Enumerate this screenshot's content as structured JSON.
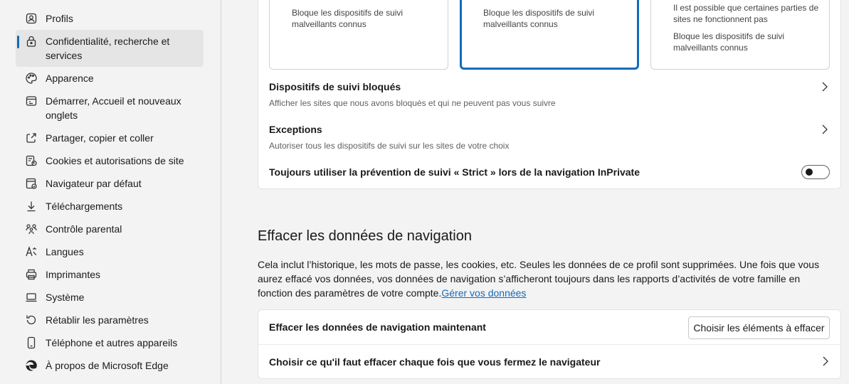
{
  "sidebar": {
    "items": [
      {
        "label": "Profils",
        "icon": "profile-icon"
      },
      {
        "label": "Confidentialité, recherche et services",
        "icon": "lock-icon",
        "active": true
      },
      {
        "label": "Apparence",
        "icon": "palette-icon"
      },
      {
        "label": "Démarrer, Accueil et nouveaux onglets",
        "icon": "home-tabs-icon"
      },
      {
        "label": "Partager, copier et coller",
        "icon": "share-icon"
      },
      {
        "label": "Cookies et autorisations de site",
        "icon": "cookies-icon"
      },
      {
        "label": "Navigateur par défaut",
        "icon": "default-browser-icon"
      },
      {
        "label": "Téléchargements",
        "icon": "download-icon"
      },
      {
        "label": "Contrôle parental",
        "icon": "family-icon"
      },
      {
        "label": "Langues",
        "icon": "language-icon"
      },
      {
        "label": "Imprimantes",
        "icon": "printer-icon"
      },
      {
        "label": "Système",
        "icon": "laptop-icon"
      },
      {
        "label": "Rétablir les paramètres",
        "icon": "reset-icon"
      },
      {
        "label": "Téléphone et autres appareils",
        "icon": "phone-icon"
      },
      {
        "label": "À propos de Microsoft Edge",
        "icon": "edge-logo-icon"
      }
    ]
  },
  "tracking": {
    "cards": [
      {
        "lines": [
          "Bloque les dispositifs de suivi malveillants connus"
        ],
        "selected": false
      },
      {
        "lines": [
          "Bloque les dispositifs de suivi malveillants connus"
        ],
        "selected": true
      },
      {
        "lines": [
          "Il est possible que certaines parties de sites ne fonctionnent pas",
          "Bloque les dispositifs de suivi malveillants connus"
        ],
        "selected": false
      }
    ],
    "blocked_title": "Dispositifs de suivi bloqués",
    "blocked_sub": "Afficher les sites que nous avons bloqués et qui ne peuvent pas vous suivre",
    "exceptions_title": "Exceptions",
    "exceptions_sub": "Autoriser tous les dispositifs de suivi sur les sites de votre choix",
    "strict_label": "Toujours utiliser la prévention de suivi « Strict » lors de la navigation InPrivate",
    "strict_toggle_on": false
  },
  "clear": {
    "title": "Effacer les données de navigation",
    "description": "Cela inclut l’historique, les mots de passe, les cookies, etc. Seules les données de ce profil sont supprimées. Une fois que vous aurez effacé vos données, vos données de navigation s’afficheront toujours dans les rapports d’activités de votre famille en fonction des paramètres de votre compte.",
    "manage_link": "Gérer vos données",
    "now_label": "Effacer les données de navigation maintenant",
    "choose_button": "Choisir les éléments à effacer",
    "on_close_label": "Choisir ce qu'il faut effacer chaque fois que vous fermez le navigateur"
  },
  "colors": {
    "accent": "#0f6cbd",
    "background": "#f3f3f3",
    "card": "#ffffff"
  }
}
